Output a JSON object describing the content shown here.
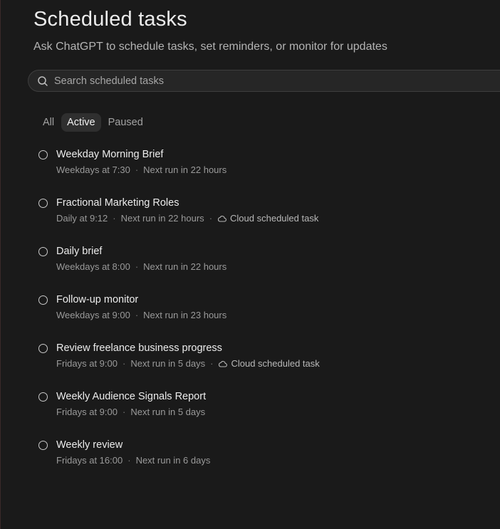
{
  "header": {
    "title": "Scheduled tasks",
    "subtitle": "Ask ChatGPT to schedule tasks, set reminders, or monitor for updates"
  },
  "search": {
    "placeholder": "Search scheduled tasks",
    "value": "",
    "icon": "search-icon"
  },
  "tabs": [
    {
      "label": "All",
      "active": false
    },
    {
      "label": "Active",
      "active": true
    },
    {
      "label": "Paused",
      "active": false
    }
  ],
  "tasks": [
    {
      "title": "Weekday Morning Brief",
      "schedule": "Weekdays at 7:30",
      "next_run": "Next run in 22 hours",
      "cloud": ""
    },
    {
      "title": "Fractional Marketing Roles",
      "schedule": "Daily at 9:12",
      "next_run": "Next run in 22 hours",
      "cloud": "Cloud scheduled task"
    },
    {
      "title": "Daily brief",
      "schedule": "Weekdays at 8:00",
      "next_run": "Next run in 22 hours",
      "cloud": ""
    },
    {
      "title": "Follow-up monitor",
      "schedule": "Weekdays at 9:00",
      "next_run": "Next run in 23 hours",
      "cloud": ""
    },
    {
      "title": "Review freelance business progress",
      "schedule": "Fridays at 9:00",
      "next_run": "Next run in 5 days",
      "cloud": "Cloud scheduled task"
    },
    {
      "title": "Weekly Audience Signals Report",
      "schedule": "Fridays at 9:00",
      "next_run": "Next run in 5 days",
      "cloud": ""
    },
    {
      "title": "Weekly review",
      "schedule": "Fridays at 16:00",
      "next_run": "Next run in 6 days",
      "cloud": ""
    }
  ],
  "separator": "·",
  "colors": {
    "background": "#1a1a1a",
    "text_primary": "#ececec",
    "text_secondary": "#9a9a9a",
    "active_tab_bg": "#2f2f2f"
  }
}
